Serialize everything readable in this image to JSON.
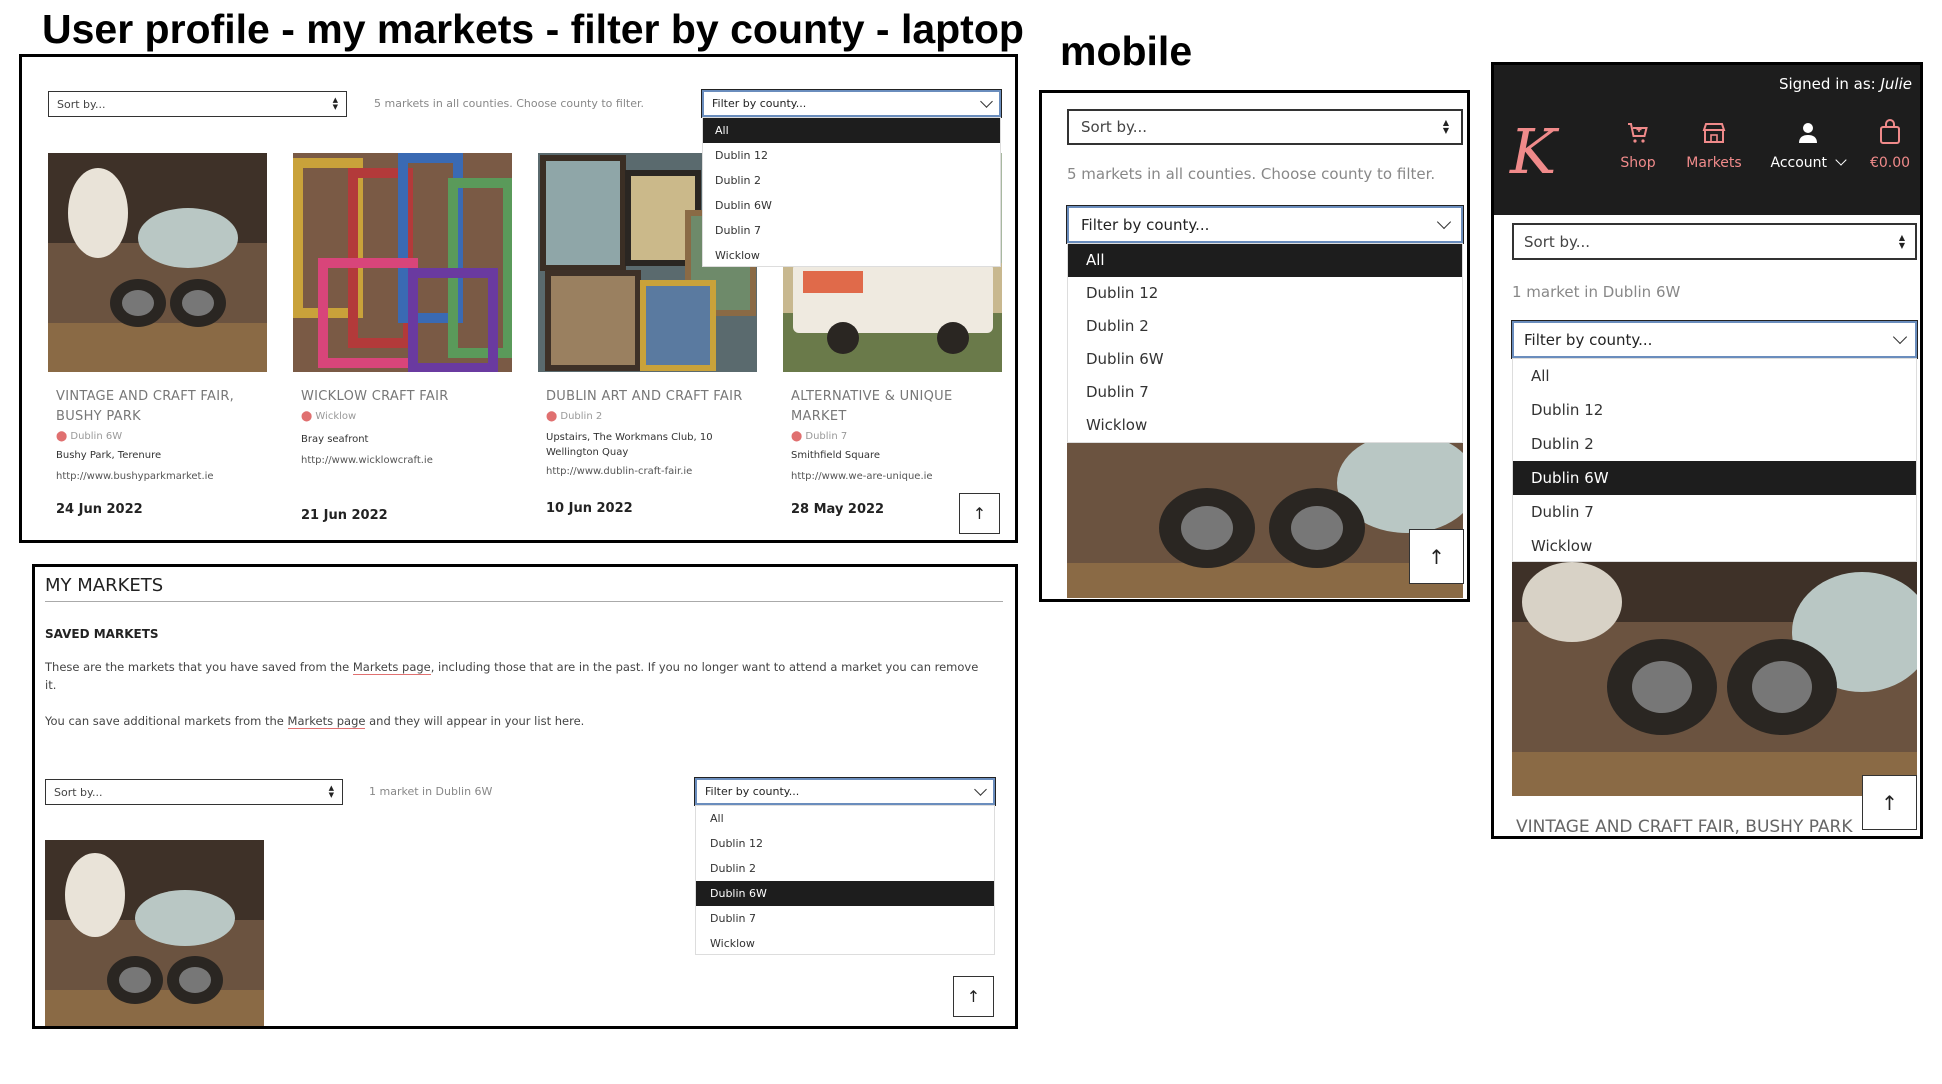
{
  "titles": {
    "laptop": "User profile - my markets - filter by county - laptop",
    "mobile": "mobile"
  },
  "common": {
    "sort_label": "Sort by...",
    "filter_label": "Filter by county...",
    "counties": [
      "All",
      "Dublin 12",
      "Dublin 2",
      "Dublin 6W",
      "Dublin 7",
      "Wicklow"
    ],
    "info_all": "5 markets in all counties. Choose county to filter.",
    "info_filtered": "1 market in Dublin 6W",
    "up_arrow": "↑"
  },
  "laptop_markets": [
    {
      "title": "VINTAGE AND CRAFT FAIR, BUSHY PARK",
      "location": "Dublin 6W",
      "address": "Bushy Park, Terenure",
      "url": "http://www.bushyparkmarket.ie",
      "date": "24 Jun 2022"
    },
    {
      "title": "WICKLOW CRAFT FAIR",
      "location": "Wicklow",
      "address": "Bray seafront",
      "url": "http://www.wicklowcraft.ie",
      "date": "21 Jun 2022"
    },
    {
      "title": "DUBLIN ART AND CRAFT FAIR",
      "location": "Dublin 2",
      "address": "Upstairs, The Workmans Club, 10 Wellington Quay",
      "url": "http://www.dublin-craft-fair.ie",
      "date": "10 Jun 2022"
    },
    {
      "title": "ALTERNATIVE & UNIQUE MARKET",
      "location": "Dublin 7",
      "address": "Smithfield Square",
      "url": "http://www.we-are-unique.ie",
      "date": "28 May 2022"
    }
  ],
  "my_markets": {
    "heading": "MY MARKETS",
    "subheading": "SAVED MARKETS",
    "para1_before": "These are the markets that you have saved from the ",
    "para1_link": "Markets page",
    "para1_after": ", including those that are in the past. If you no longer want to attend a market you can remove it.",
    "para2_before": "You can save additional markets from the ",
    "para2_link": "Markets page",
    "para2_after": " and they will appear in your list here."
  },
  "mobile_nav": {
    "signed_in_label": "Signed in as:",
    "user": "Julie",
    "logo": "K",
    "shop": "Shop",
    "markets": "Markets",
    "account": "Account",
    "cart": "€0.00",
    "card_title": "VINTAGE AND CRAFT FAIR, BUSHY PARK"
  },
  "colors": {
    "accent": "#f08a8a",
    "dark": "#1d1d1d",
    "focus": "#6a8dbd"
  }
}
